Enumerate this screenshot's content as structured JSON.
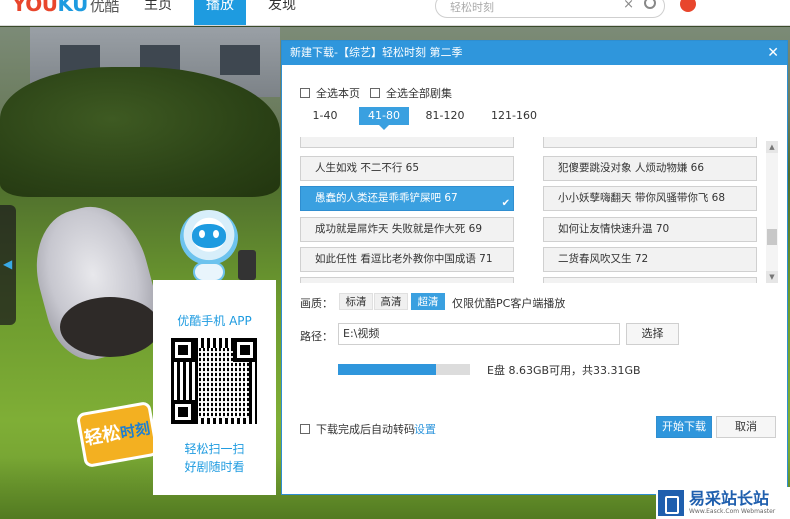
{
  "header": {
    "logo_text_a": "YOU",
    "logo_text_b": "KU",
    "logo_cn": "优酷",
    "nav": [
      {
        "label": "主页",
        "active": false
      },
      {
        "label": "播放",
        "active": true
      },
      {
        "label": "发现",
        "active": false
      }
    ],
    "search_placeholder": "轻松时刻",
    "clear_glyph": "×"
  },
  "player": {
    "left_arrow_glyph": "◀",
    "badge_text": "轻松",
    "badge_sub": "时刻"
  },
  "promo": {
    "title": "优酷手机 APP",
    "line1": "轻松扫一扫",
    "line2": "好剧随时看"
  },
  "dialog": {
    "title": "新建下载-【综艺】轻松时刻 第二季",
    "close_glyph": "✕",
    "select_page": "全选本页",
    "select_all": "全选全部剧集",
    "tabs": [
      {
        "label": "1-40",
        "active": false
      },
      {
        "label": "41-80",
        "active": true
      },
      {
        "label": "81-120",
        "active": false
      },
      {
        "label": "121-160",
        "active": false
      }
    ],
    "episodes": [
      {
        "label": "人生如戏 不二不行 65",
        "selected": false
      },
      {
        "label": "犯傻要跳没对象 人烦动物嫌 66",
        "selected": false
      },
      {
        "label": "愚蠢的人类还是乖乖铲屎吧 67",
        "selected": true
      },
      {
        "label": "小小妖孽嗨翻天 带你风骚带你飞 68",
        "selected": false
      },
      {
        "label": "成功就是屌炸天 失败就是作大死 69",
        "selected": false
      },
      {
        "label": "如何让友情快速升温 70",
        "selected": false
      },
      {
        "label": "如此任性 看逗比老外教你中国成语 71",
        "selected": false
      },
      {
        "label": "二货春风吹又生 72",
        "selected": false
      }
    ],
    "quality_label": "画质：",
    "quality_options": [
      {
        "label": "标清",
        "active": false
      },
      {
        "label": "高清",
        "active": false
      },
      {
        "label": "超清",
        "active": true
      }
    ],
    "quality_note": "仅限优酷PC客户端播放",
    "path_label": "路径：",
    "path_value": "E:\\视频",
    "browse_label": "选择",
    "disk_used_fraction": 0.74,
    "disk_text": "E盘 8.63GB可用，共33.31GB",
    "auto_transcode_label": "下载完成后自动转码",
    "settings_link": "设置",
    "start_label": "开始下载",
    "cancel_label": "取消"
  },
  "watermark": {
    "title": "易采站长站",
    "subtitle": "Www.Easck.Com Webmaster"
  }
}
